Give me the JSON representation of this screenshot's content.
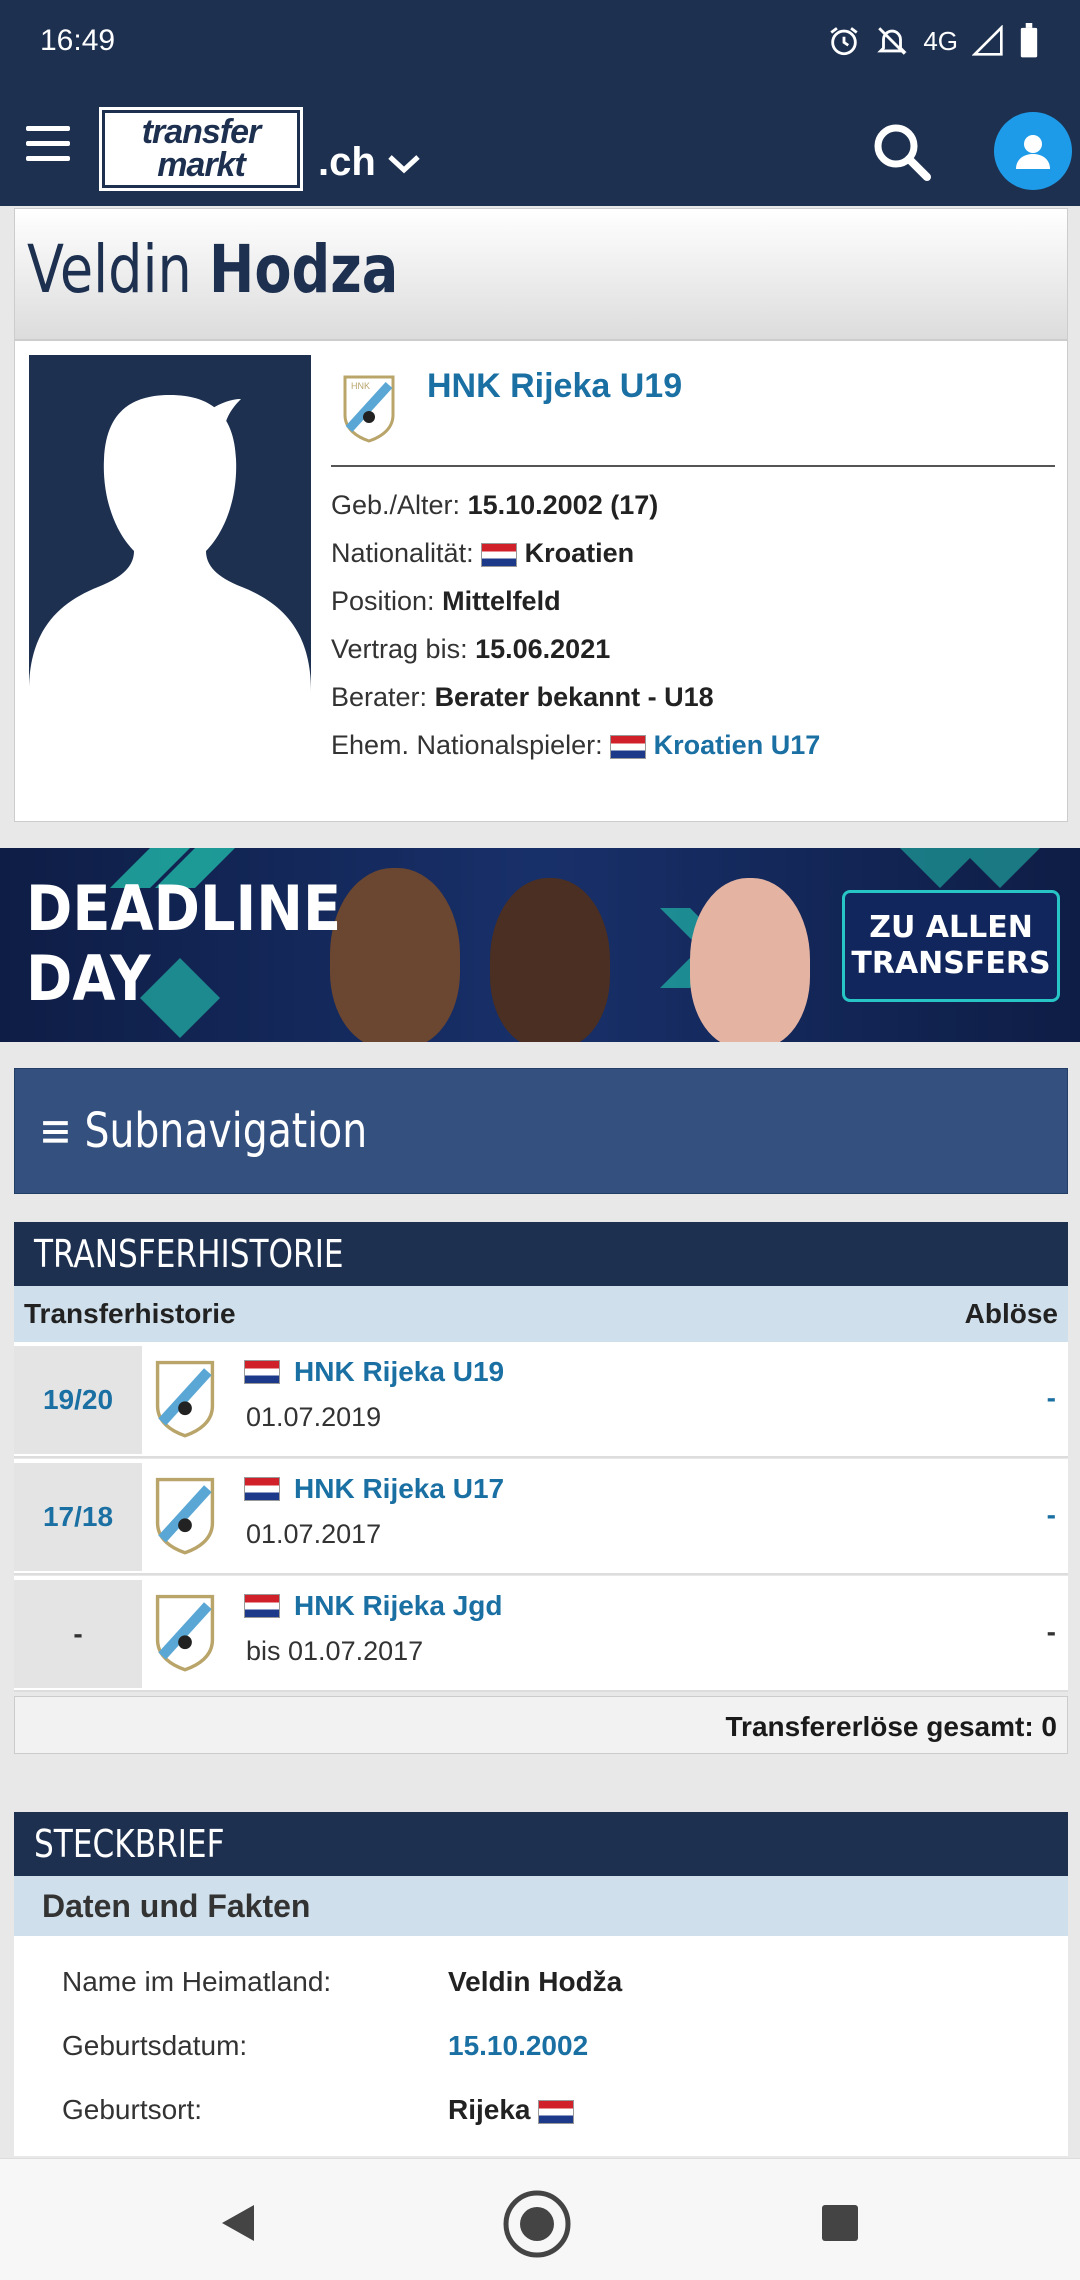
{
  "status": {
    "time": "16:49",
    "network": "4G"
  },
  "header": {
    "logo_line1": "transfer",
    "logo_line2": "markt",
    "domain": ".ch"
  },
  "player": {
    "first_name": "Veldin",
    "last_name": "Hodza"
  },
  "club": {
    "name": "HNK Rijeka U19"
  },
  "facts": [
    {
      "label": "Geb./Alter:",
      "value": "15.10.2002 (17)"
    },
    {
      "label": "Nationalität:",
      "value": "Kroatien",
      "flag": "croatia"
    },
    {
      "label": "Position:",
      "value": "Mittelfeld"
    },
    {
      "label": "Vertrag bis:",
      "value": "15.06.2021"
    },
    {
      "label": "Berater:",
      "value": "Berater bekannt - U18"
    },
    {
      "label": "Ehem. Nationalspieler:",
      "value": "Kroatien U17",
      "flag": "croatia"
    }
  ],
  "banner": {
    "line1": "DEADLINE",
    "line2": "DAY",
    "cta_line1": "ZU ALLEN",
    "cta_line2": "TRANSFERS"
  },
  "subnav": {
    "icon": "menu-icon",
    "label": "Subnavigation"
  },
  "transfers": {
    "title": "TRANSFERHISTORIE",
    "col_left": "Transferhistorie",
    "col_right": "Ablöse",
    "rows": [
      {
        "season": "19/20",
        "club": "HNK Rijeka U19",
        "date": "01.07.2019",
        "fee": "-"
      },
      {
        "season": "17/18",
        "club": "HNK Rijeka U17",
        "date": "01.07.2017",
        "fee": "-"
      },
      {
        "season": "-",
        "club": "HNK Rijeka Jgd",
        "date": "bis 01.07.2017",
        "fee": "-"
      }
    ],
    "total": "Transfererlöse gesamt: 0"
  },
  "profile": {
    "title": "STECKBRIEF",
    "subtitle": "Daten und Fakten",
    "rows": [
      {
        "label": "Name im Heimatland:",
        "value": "Veldin Hodža"
      },
      {
        "label": "Geburtsdatum:",
        "value": "15.10.2002"
      },
      {
        "label": "Geburtsort:",
        "value": "Rijeka"
      }
    ]
  },
  "colors": {
    "navy": "#1d3050",
    "link": "#1a6fa3",
    "accent": "#1e9be8",
    "light_blue": "#cfe0ec"
  }
}
